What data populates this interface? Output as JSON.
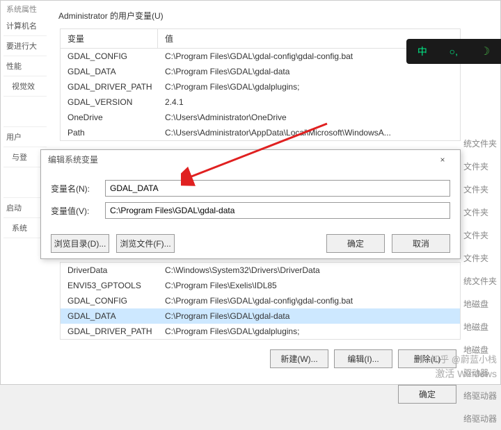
{
  "bg": {
    "title": "系统属性",
    "tabs": [
      "计算机名",
      "要进行大",
      "性能",
      "视觉效",
      "用户",
      "与登",
      "启动",
      "系统"
    ]
  },
  "user_section": {
    "label": "Administrator 的用户变量(U)",
    "header_name": "变量",
    "header_value": "值",
    "rows": [
      {
        "name": "GDAL_CONFIG",
        "value": "C:\\Program Files\\GDAL\\gdal-config\\gdal-config.bat"
      },
      {
        "name": "GDAL_DATA",
        "value": "C:\\Program Files\\GDAL\\gdal-data"
      },
      {
        "name": "GDAL_DRIVER_PATH",
        "value": "C:\\Program Files\\GDAL\\gdalplugins;"
      },
      {
        "name": "GDAL_VERSION",
        "value": "2.4.1"
      },
      {
        "name": "OneDrive",
        "value": "C:\\Users\\Administrator\\OneDrive"
      },
      {
        "name": "Path",
        "value": "C:\\Users\\Administrator\\AppData\\Local\\Microsoft\\WindowsA..."
      }
    ]
  },
  "dialog": {
    "title": "编辑系统变量",
    "name_label": "变量名(N):",
    "name_value": "GDAL_DATA",
    "value_label": "变量值(V):",
    "value_value": "C:\\Program Files\\GDAL\\gdal-data",
    "browse_dir": "浏览目录(D)...",
    "browse_file": "浏览文件(F)...",
    "ok": "确定",
    "cancel": "取消"
  },
  "sys_section": {
    "rows": [
      {
        "name": "DriverData",
        "value": "C:\\Windows\\System32\\Drivers\\DriverData"
      },
      {
        "name": "ENVI53_GPTOOLS",
        "value": "C:\\Program Files\\Exelis\\IDL85"
      },
      {
        "name": "GDAL_CONFIG",
        "value": "C:\\Program Files\\GDAL\\gdal-config\\gdal-config.bat"
      },
      {
        "name": "GDAL_DATA",
        "value": "C:\\Program Files\\GDAL\\gdal-data"
      },
      {
        "name": "GDAL_DRIVER_PATH",
        "value": "C:\\Program Files\\GDAL\\gdalplugins;"
      }
    ]
  },
  "bottom_btns": {
    "new": "新建(W)...",
    "edit": "编辑(I)...",
    "delete": "删除(L)",
    "ok": "确定"
  },
  "ime": {
    "ch": "中",
    "punct": "○,",
    "moon": "☽"
  },
  "side_labels": [
    "统文件夹",
    "文件夹",
    "文件夹",
    "文件夹",
    "文件夹",
    "文件夹",
    "统文件夹",
    "地磁盘",
    "地磁盘",
    "地磁盘",
    "驱动器",
    "络驱动器",
    "络驱动器"
  ],
  "watermark": {
    "l1": "知乎 @蔚蓝小栈",
    "l2": "激活 Windows"
  }
}
